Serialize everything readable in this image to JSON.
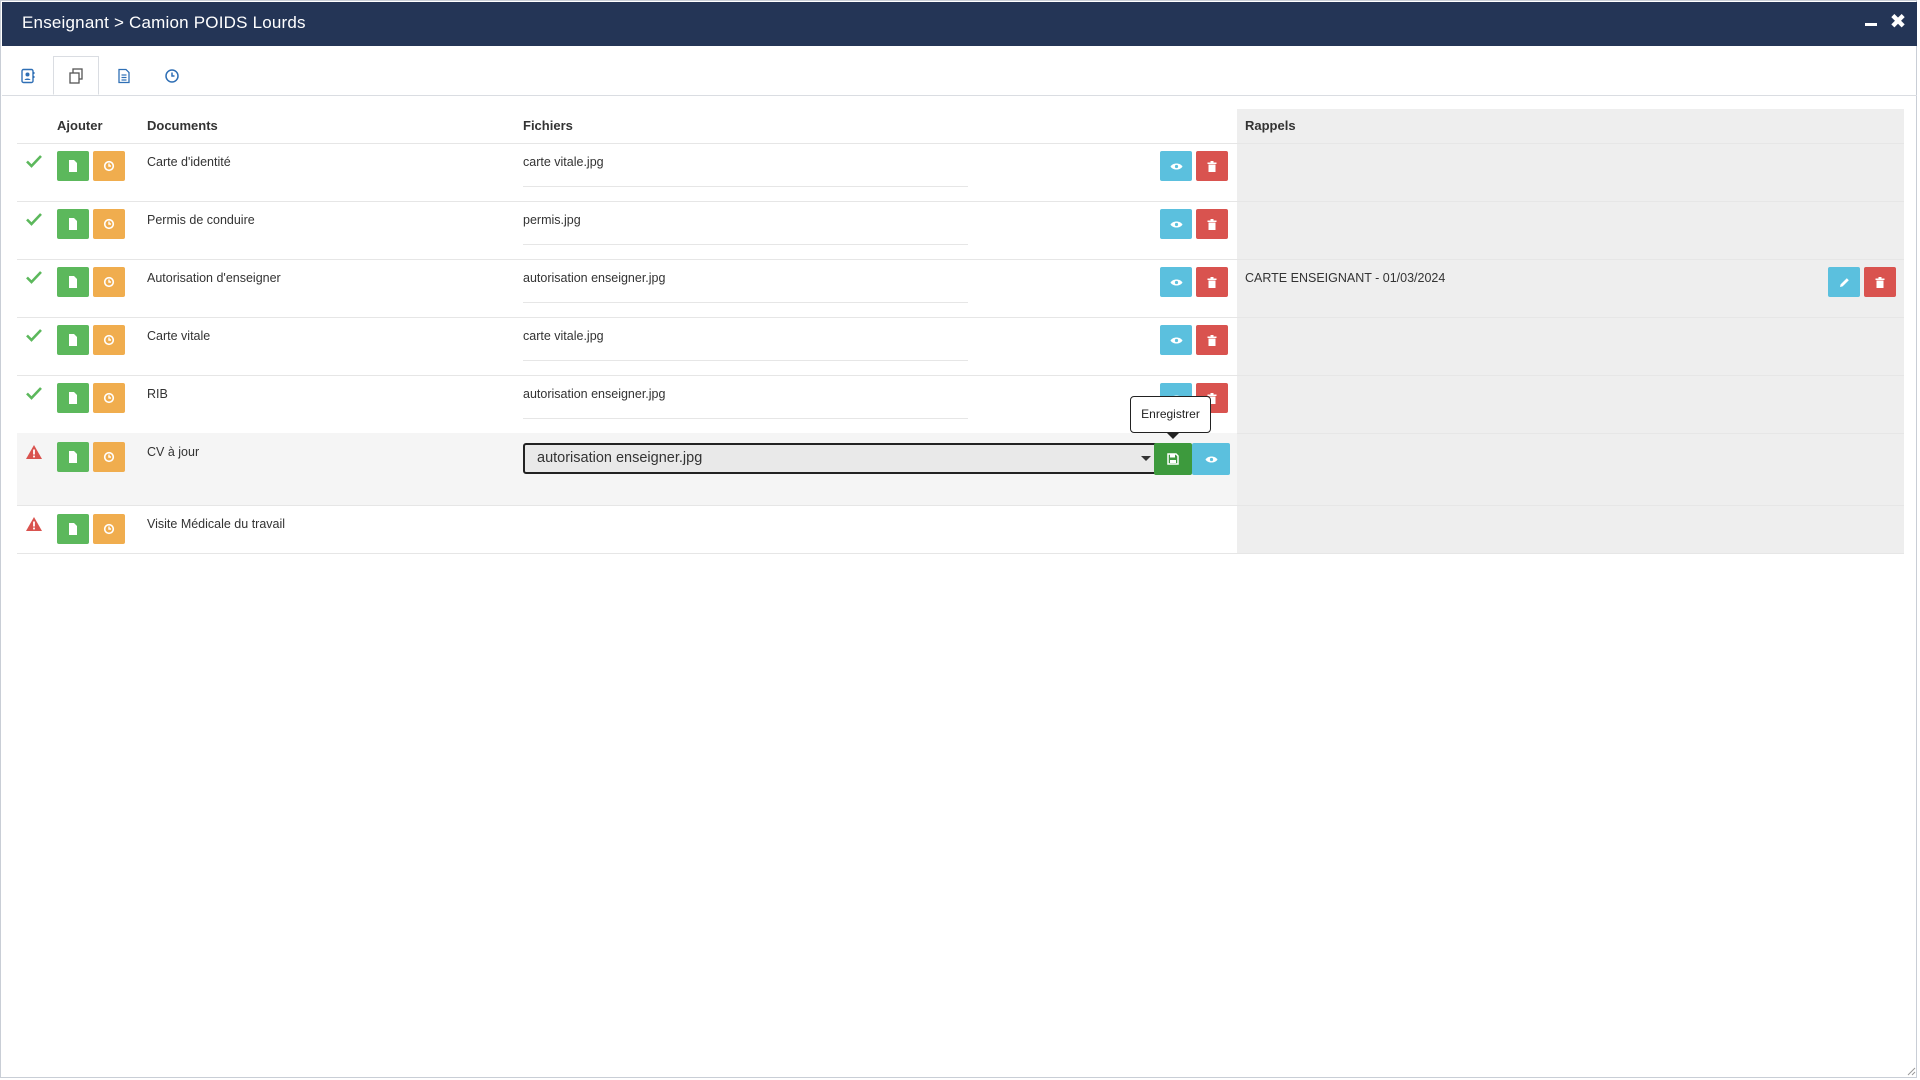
{
  "window": {
    "title": "Enseignant > Camion POIDS Lourds",
    "minimize_icon": "minimize-icon",
    "close_icon": "close-icon"
  },
  "tabs": [
    {
      "icon": "contact-card-icon",
      "active": false
    },
    {
      "icon": "documents-copy-icon",
      "active": true
    },
    {
      "icon": "file-text-icon",
      "active": false
    },
    {
      "icon": "clock-icon",
      "active": false
    }
  ],
  "table": {
    "headers": {
      "ajouter": "Ajouter",
      "documents": "Documents",
      "fichiers": "Fichiers",
      "rappels": "Rappels"
    },
    "rows": [
      {
        "status": "ok",
        "document": "Carte d'identité",
        "file": "carte vitale.jpg",
        "rappel": ""
      },
      {
        "status": "ok",
        "document": "Permis de conduire",
        "file": "permis.jpg",
        "rappel": ""
      },
      {
        "status": "ok",
        "document": "Autorisation d'enseigner",
        "file": "autorisation enseigner.jpg",
        "rappel": "CARTE ENSEIGNANT - 01/03/2024"
      },
      {
        "status": "ok",
        "document": "Carte vitale",
        "file": "carte vitale.jpg",
        "rappel": ""
      },
      {
        "status": "ok",
        "document": "RIB",
        "file": "autorisation enseigner.jpg",
        "rappel": ""
      },
      {
        "status": "warning",
        "document": "CV à jour",
        "file_select": "autorisation enseigner.jpg",
        "rappel": ""
      },
      {
        "status": "warning",
        "document": "Visite Médicale du travail",
        "file": "",
        "rappel": ""
      }
    ]
  },
  "tooltip": {
    "text": "Enregistrer"
  },
  "colors": {
    "titlebar": "#243556",
    "green": "#5cb85c",
    "orange": "#f0ad4e",
    "blue": "#5bc0de",
    "red": "#d9534f",
    "warning": "#d9534f",
    "reminder_bg": "#eeeeee"
  }
}
